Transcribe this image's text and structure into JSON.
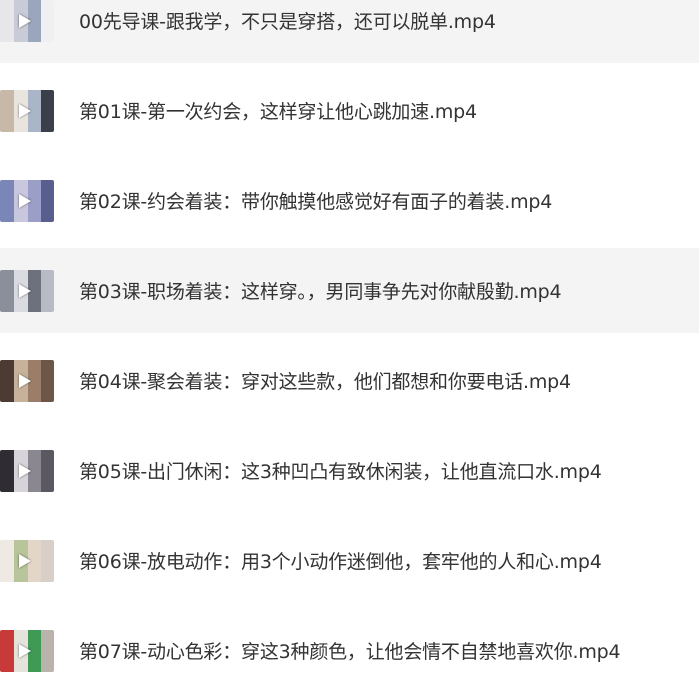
{
  "files": [
    {
      "name": "00先导课-跟我学，不只是穿搭，还可以脱单.mp4",
      "thumb_colors": [
        "#e7e7ea",
        "#c9ccd6",
        "#9aa6bb",
        "#f0f0f2"
      ]
    },
    {
      "name": "第01课-第一次约会，这样穿让他心跳加速.mp4",
      "thumb_colors": [
        "#c7b8a8",
        "#e9e4de",
        "#aab6c8",
        "#3b3f4a"
      ]
    },
    {
      "name": "第02课-约会着装：带你触摸他感觉好有面子的着装.mp4",
      "thumb_colors": [
        "#7b86b8",
        "#c8c7de",
        "#9b9fc8",
        "#585f8f"
      ]
    },
    {
      "name": "第03课-职场着装：这样穿。，男同事争先对你献殷勤.mp4",
      "thumb_colors": [
        "#8b8f9a",
        "#dadbe0",
        "#6d717d",
        "#b8bbc4"
      ]
    },
    {
      "name": "第04课-聚会着装：穿对这些款，他们都想和你要电话.mp4",
      "thumb_colors": [
        "#4d3b33",
        "#c7b19b",
        "#9a7e6a",
        "#6b5648"
      ]
    },
    {
      "name": "第05课-出门休闲：这3种凹凸有致休闲装，让他直流口水.mp4",
      "thumb_colors": [
        "#2f2d33",
        "#d6d4d8",
        "#8a8790",
        "#5a5860"
      ]
    },
    {
      "name": "第06课-放电动作：用3个小动作迷倒他，套牢他的人和心.mp4",
      "thumb_colors": [
        "#efe9e3",
        "#b8c49a",
        "#e3d6c9",
        "#d7cfc8"
      ]
    },
    {
      "name": "第07课-动心色彩：穿这3种颜色，让他会情不自禁地喜欢你.mp4",
      "thumb_colors": [
        "#c83a3a",
        "#e6e2dc",
        "#3f9a56",
        "#b9b3ab"
      ]
    }
  ],
  "shaded_rows": [
    0,
    3
  ]
}
